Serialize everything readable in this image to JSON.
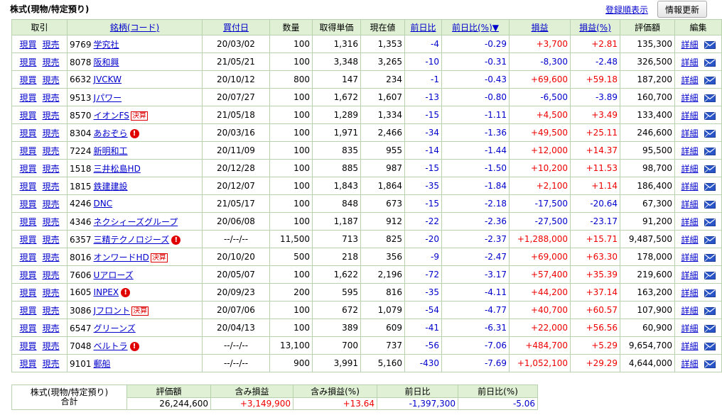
{
  "header": {
    "title": "株式(現物/特定預り)",
    "sort_link": "登録順表示",
    "refresh_button": "情報更新"
  },
  "columns": [
    "取引",
    "銘柄(コード)",
    "買付日",
    "数量",
    "取得単価",
    "現在値",
    "前日比",
    "前日比(%)▼",
    "損益",
    "損益(%)",
    "評価額",
    "編集"
  ],
  "trade_labels": {
    "buy": "現買",
    "sell": "現売"
  },
  "detail_label": "詳細",
  "badge_label": "決算",
  "alert_mark": "!",
  "rows": [
    {
      "code": "9769",
      "name": "学究社",
      "date": "20/03/02",
      "qty": "100",
      "cost": "1,316",
      "price": "1,353",
      "chg": "-4",
      "chg_pct": "-0.29",
      "pl": "+3,700",
      "pl_pct": "+2.81",
      "value": "135,300",
      "badge": false,
      "alert": false
    },
    {
      "code": "8078",
      "name": "阪和興",
      "date": "21/05/21",
      "qty": "100",
      "cost": "3,348",
      "price": "3,265",
      "chg": "-10",
      "chg_pct": "-0.31",
      "pl": "-8,300",
      "pl_pct": "-2.48",
      "value": "326,500",
      "badge": false,
      "alert": false
    },
    {
      "code": "6632",
      "name": "JVCKW",
      "date": "20/10/12",
      "qty": "800",
      "cost": "147",
      "price": "234",
      "chg": "-1",
      "chg_pct": "-0.43",
      "pl": "+69,600",
      "pl_pct": "+59.18",
      "value": "187,200",
      "badge": false,
      "alert": false
    },
    {
      "code": "9513",
      "name": "Jパワー",
      "date": "20/07/27",
      "qty": "100",
      "cost": "1,672",
      "price": "1,607",
      "chg": "-13",
      "chg_pct": "-0.80",
      "pl": "-6,500",
      "pl_pct": "-3.89",
      "value": "160,700",
      "badge": false,
      "alert": false
    },
    {
      "code": "8570",
      "name": "イオンFS",
      "date": "21/05/18",
      "qty": "100",
      "cost": "1,289",
      "price": "1,334",
      "chg": "-15",
      "chg_pct": "-1.11",
      "pl": "+4,500",
      "pl_pct": "+3.49",
      "value": "133,400",
      "badge": true,
      "alert": false
    },
    {
      "code": "8304",
      "name": "あおぞら",
      "date": "20/03/16",
      "qty": "100",
      "cost": "1,971",
      "price": "2,466",
      "chg": "-34",
      "chg_pct": "-1.36",
      "pl": "+49,500",
      "pl_pct": "+25.11",
      "value": "246,600",
      "badge": false,
      "alert": true
    },
    {
      "code": "7224",
      "name": "新明和工",
      "date": "20/11/09",
      "qty": "100",
      "cost": "835",
      "price": "955",
      "chg": "-14",
      "chg_pct": "-1.44",
      "pl": "+12,000",
      "pl_pct": "+14.37",
      "value": "95,500",
      "badge": false,
      "alert": false
    },
    {
      "code": "1518",
      "name": "三井松島HD",
      "date": "20/12/28",
      "qty": "100",
      "cost": "885",
      "price": "987",
      "chg": "-15",
      "chg_pct": "-1.50",
      "pl": "+10,200",
      "pl_pct": "+11.53",
      "value": "98,700",
      "badge": false,
      "alert": false
    },
    {
      "code": "1815",
      "name": "鉄建建設",
      "date": "20/12/07",
      "qty": "100",
      "cost": "1,843",
      "price": "1,864",
      "chg": "-35",
      "chg_pct": "-1.84",
      "pl": "+2,100",
      "pl_pct": "+1.14",
      "value": "186,400",
      "badge": false,
      "alert": false
    },
    {
      "code": "4246",
      "name": "DNC",
      "date": "21/05/17",
      "qty": "100",
      "cost": "848",
      "price": "673",
      "chg": "-15",
      "chg_pct": "-2.18",
      "pl": "-17,500",
      "pl_pct": "-20.64",
      "value": "67,300",
      "badge": false,
      "alert": false
    },
    {
      "code": "4346",
      "name": "ネクシィーズグループ",
      "date": "20/06/08",
      "qty": "100",
      "cost": "1,187",
      "price": "912",
      "chg": "-22",
      "chg_pct": "-2.36",
      "pl": "-27,500",
      "pl_pct": "-23.17",
      "value": "91,200",
      "badge": false,
      "alert": false
    },
    {
      "code": "6357",
      "name": "三精テクノロジーズ",
      "date": "--/--/--",
      "qty": "11,500",
      "cost": "713",
      "price": "825",
      "chg": "-20",
      "chg_pct": "-2.37",
      "pl": "+1,288,000",
      "pl_pct": "+15.71",
      "value": "9,487,500",
      "badge": false,
      "alert": true
    },
    {
      "code": "8016",
      "name": "オンワードHD",
      "date": "20/10/20",
      "qty": "500",
      "cost": "218",
      "price": "356",
      "chg": "-9",
      "chg_pct": "-2.47",
      "pl": "+69,000",
      "pl_pct": "+63.30",
      "value": "178,000",
      "badge": true,
      "alert": false
    },
    {
      "code": "7606",
      "name": "Uアローズ",
      "date": "20/05/07",
      "qty": "100",
      "cost": "1,622",
      "price": "2,196",
      "chg": "-72",
      "chg_pct": "-3.17",
      "pl": "+57,400",
      "pl_pct": "+35.39",
      "value": "219,600",
      "badge": false,
      "alert": false
    },
    {
      "code": "1605",
      "name": "INPEX",
      "date": "20/09/23",
      "qty": "200",
      "cost": "595",
      "price": "816",
      "chg": "-35",
      "chg_pct": "-4.11",
      "pl": "+44,200",
      "pl_pct": "+37.14",
      "value": "163,200",
      "badge": false,
      "alert": true
    },
    {
      "code": "3086",
      "name": "Jフロント",
      "date": "20/07/06",
      "qty": "100",
      "cost": "672",
      "price": "1,079",
      "chg": "-54",
      "chg_pct": "-4.77",
      "pl": "+40,700",
      "pl_pct": "+60.57",
      "value": "107,900",
      "badge": true,
      "alert": false
    },
    {
      "code": "6547",
      "name": "グリーンズ",
      "date": "20/04/13",
      "qty": "100",
      "cost": "389",
      "price": "609",
      "chg": "-41",
      "chg_pct": "-6.31",
      "pl": "+22,000",
      "pl_pct": "+56.56",
      "value": "60,900",
      "badge": false,
      "alert": false
    },
    {
      "code": "7048",
      "name": "ベルトラ",
      "date": "--/--/--",
      "qty": "13,100",
      "cost": "700",
      "price": "737",
      "chg": "-56",
      "chg_pct": "-7.06",
      "pl": "+484,700",
      "pl_pct": "+5.29",
      "value": "9,654,700",
      "badge": false,
      "alert": true
    },
    {
      "code": "9101",
      "name": "郵船",
      "date": "--/--/--",
      "qty": "900",
      "cost": "3,991",
      "price": "5,160",
      "chg": "-430",
      "chg_pct": "-7.69",
      "pl": "+1,052,100",
      "pl_pct": "+29.29",
      "value": "4,644,000",
      "badge": false,
      "alert": false
    }
  ],
  "summary": {
    "label_line1": "株式(現物/特定預り)",
    "label_line2": "合計",
    "headers": [
      "評価額",
      "含み損益",
      "含み損益(%)",
      "前日比",
      "前日比(%)"
    ],
    "values": [
      "26,244,600",
      "+3,149,900",
      "+13.64",
      "-1,397,300",
      "-5.06"
    ]
  },
  "colors": {
    "header_bg": "#dff0d4",
    "border": "#b7d2ad",
    "positive": "#ee0000",
    "negative": "#0000cc",
    "link": "#0000cc"
  },
  "icons": {
    "alert": "exclamation-circle-icon",
    "mail": "envelope-icon"
  }
}
